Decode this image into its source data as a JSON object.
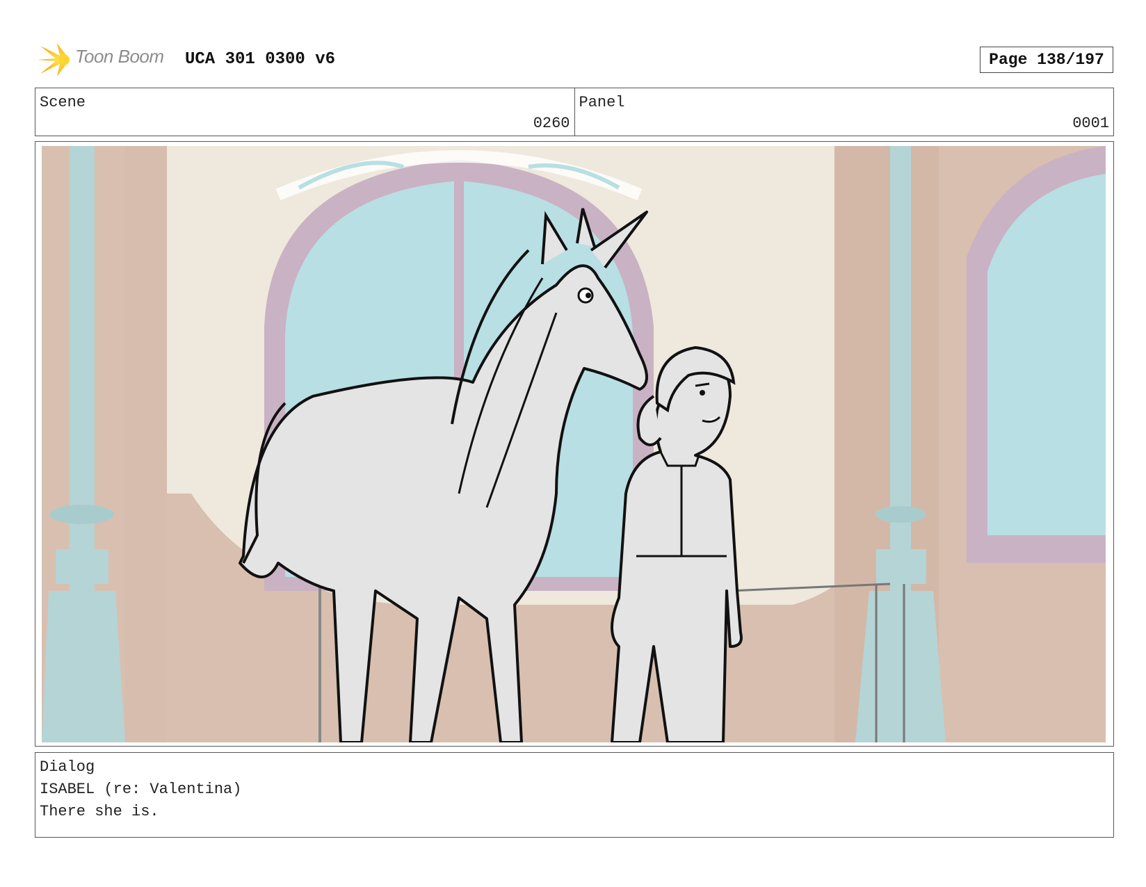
{
  "header": {
    "logo_text": "Toon Boom",
    "doc_title": "UCA 301 0300 v6",
    "page_label": "Page 138/197"
  },
  "meta": {
    "scene_label": "Scene",
    "scene_value": "0260",
    "panel_label": "Panel",
    "panel_value": "0001"
  },
  "panel_image": {
    "description_name": "storyboard-drawing",
    "colors": {
      "wall": "#d9c0b0",
      "window_glass": "#b9dfe2",
      "window_frame": "#c9b3c4",
      "pillar": "#b4d3d4",
      "line": "#111111"
    }
  },
  "dialog": {
    "label": "Dialog",
    "speaker": "ISABEL (re: Valentina)",
    "line": "There she is."
  }
}
